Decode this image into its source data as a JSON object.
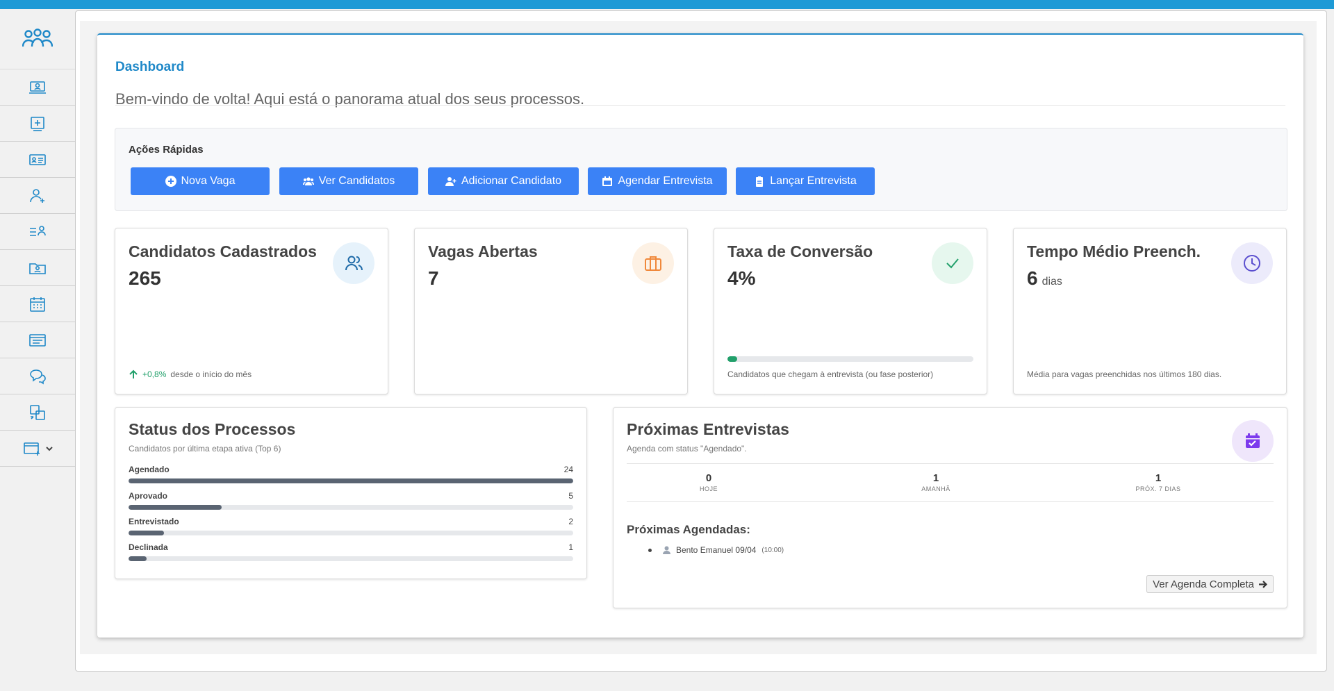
{
  "sidebar": {
    "logo_icon": "users-group-icon",
    "items": [
      {
        "icon": "laptop-user-icon"
      },
      {
        "icon": "add-window-icon"
      },
      {
        "icon": "id-card-icon"
      },
      {
        "icon": "user-add-icon"
      },
      {
        "icon": "user-list-icon"
      },
      {
        "icon": "folder-user-icon"
      },
      {
        "icon": "calendar-icon"
      },
      {
        "icon": "document-list-icon"
      },
      {
        "icon": "chat-icon"
      },
      {
        "icon": "swap-icon"
      },
      {
        "icon": "card-add-icon"
      }
    ]
  },
  "main": {
    "title": "Dashboard",
    "welcome": "Bem-vindo de volta! Aqui está o panorama atual dos seus processos."
  },
  "quick_actions": {
    "title": "Ações Rápidas",
    "buttons": [
      {
        "label": "Nova Vaga",
        "icon": "plus-circle-icon"
      },
      {
        "label": "Ver Candidatos",
        "icon": "users-icon"
      },
      {
        "label": "Adicionar Candidato",
        "icon": "user-plus-icon"
      },
      {
        "label": "Agendar Entrevista",
        "icon": "calendar-icon"
      },
      {
        "label": "Lançar Entrevista",
        "icon": "clipboard-icon"
      }
    ]
  },
  "stats": [
    {
      "title": "Candidatos Cadastrados",
      "value": "265",
      "unit": "",
      "icon": "users-icon",
      "change": "+0,8%",
      "foot": "desde o início do mês"
    },
    {
      "title": "Vagas Abertas",
      "value": "7",
      "unit": "",
      "icon": "briefcase-icon",
      "foot": ""
    },
    {
      "title": "Taxa de Conversão",
      "value": "4%",
      "unit": "",
      "icon": "check-icon",
      "progress": 0.04,
      "foot": "Candidatos que chegam à entrevista (ou fase posterior)"
    },
    {
      "title": "Tempo Médio Preench.",
      "value": "6",
      "unit": "dias",
      "icon": "clock-icon",
      "foot": "Média para vagas preenchidas nos últimos 180 dias."
    }
  ],
  "status": {
    "title": "Status dos Processos",
    "subtitle": "Candidatos por última etapa ativa (Top 6)",
    "rows": [
      {
        "label": "Agendado",
        "value": "24",
        "fraction": 1.0
      },
      {
        "label": "Aprovado",
        "value": "5",
        "fraction": 0.21
      },
      {
        "label": "Entrevistado",
        "value": "2",
        "fraction": 0.08
      },
      {
        "label": "Declinada",
        "value": "1",
        "fraction": 0.04
      }
    ]
  },
  "interviews": {
    "title": "Próximas Entrevistas",
    "subtitle": "Agenda com status \"Agendado\".",
    "icon": "calendar-check-icon",
    "counts": [
      {
        "value": "0",
        "label": "HOJE"
      },
      {
        "value": "1",
        "label": "AMANHÃ"
      },
      {
        "value": "1",
        "label": "PRÓX. 7 DIAS"
      }
    ],
    "next_title": "Próximas Agendadas:",
    "next": [
      {
        "name": "Bento Emanuel 09/04",
        "time": "(10:00)"
      }
    ],
    "agenda_button": "Ver Agenda Completa"
  },
  "colors": {
    "accent": "#1e88c8",
    "button": "#3b82f6",
    "success": "#22a06b",
    "bar": "#5a6472"
  }
}
